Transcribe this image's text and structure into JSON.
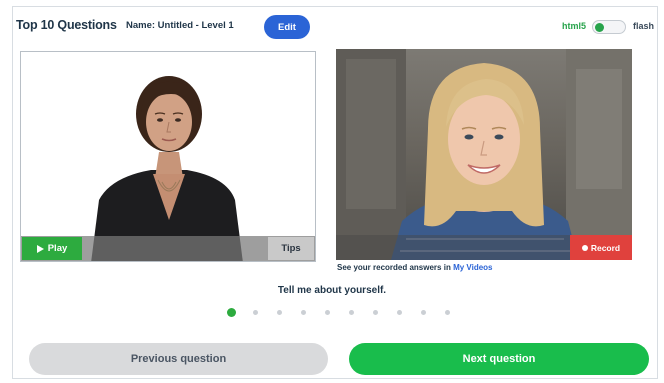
{
  "header": {
    "title": "Top 10 Questions",
    "name_label": "Name: Untitled - Level 1",
    "edit_label": "Edit",
    "toggle": {
      "left_label": "html5",
      "right_label": "flash",
      "selected": "html5"
    }
  },
  "left_panel": {
    "play_label": "Play",
    "tips_label": "Tips",
    "play_icon": "play-triangle-icon"
  },
  "right_panel": {
    "record_label": "Record",
    "record_icon": "record-dot-icon"
  },
  "recorded_note": {
    "prefix": "See your recorded answers in",
    "link": "My Videos"
  },
  "question_text": "Tell me about yourself.",
  "progress": {
    "total": 10,
    "current": 1
  },
  "navigation": {
    "previous_label": "Previous question",
    "next_label": "Next question"
  },
  "colors": {
    "accent_blue": "#2b64d6",
    "accent_green": "#19bd4c",
    "record_red": "#e0413d",
    "text_dark": "#1f3548"
  }
}
